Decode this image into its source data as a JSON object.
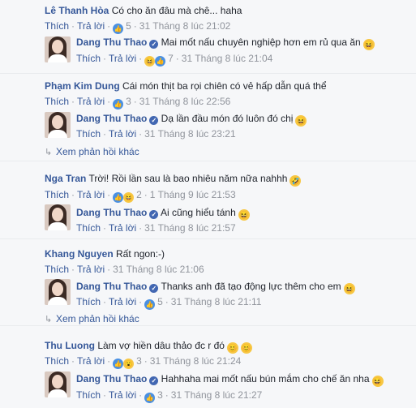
{
  "labels": {
    "like": "Thích",
    "reply": "Trả lời",
    "dot": "·"
  },
  "threads": [
    {
      "comment": {
        "name": "Lê Thanh Hòa",
        "text": "Có cho ăn đâu mà chê... haha",
        "count": "5",
        "time": "31 Tháng 8 lúc 21:02"
      },
      "reply": {
        "name": "Dang Thu Thao",
        "text": "Mai mốt nấu chuyên nghiệp hơn em rủ qua ăn",
        "count": "7",
        "time": "31 Tháng 8 lúc 21:04"
      }
    },
    {
      "comment": {
        "name": "Phạm Kim Dung",
        "text": "Cái món thịt ba rọi chiên có vẻ hấp dẫn quá thể",
        "count": "3",
        "time": "31 Tháng 8 lúc 22:56"
      },
      "reply": {
        "name": "Dang Thu Thao",
        "text": "Dạ lần đầu món đó luôn đó chị",
        "count": "",
        "time": "31 Tháng 8 lúc 23:21"
      },
      "more": "Xem phản hồi khác"
    },
    {
      "comment": {
        "name": "Nga Tran",
        "text": "Trời! Rồi lần sau là bao nhiêu năm nữa nahhh",
        "count": "2",
        "time": "1 Tháng 9 lúc 21:53"
      },
      "reply": {
        "name": "Dang Thu Thao",
        "text": "Ai cũng hiểu tánh",
        "count": "",
        "time": "31 Tháng 8 lúc 21:57"
      }
    },
    {
      "comment": {
        "name": "Khang Nguyen",
        "text": "Rất ngon:-)",
        "count": "",
        "time": "31 Tháng 8 lúc 21:06"
      },
      "reply": {
        "name": "Dang Thu Thao",
        "text": "Thanks anh đã tạo động lực thêm cho em",
        "count": "5",
        "time": "31 Tháng 8 lúc 21:11"
      },
      "more": "Xem phản hồi khác"
    },
    {
      "comment": {
        "name": "Thu Luong",
        "text": "Làm vợ hiền dâu thảo đc r đó",
        "count": "3",
        "time": "31 Tháng 8 lúc 21:24"
      },
      "reply": {
        "name": "Dang Thu Thao",
        "text": "Hahhaha mai mốt nấu bún mắm cho chế ăn nha",
        "count": "3",
        "time": "31 Tháng 8 lúc 21:27"
      }
    }
  ],
  "icons": {
    "like": "like-icon",
    "haha": "haha-icon",
    "wow": "wow-icon",
    "verified": "verified-badge-icon",
    "arrow": "reply-arrow-icon"
  },
  "colors": {
    "name": "#365899",
    "meta": "#90949c",
    "background": "#f6f7f9"
  }
}
